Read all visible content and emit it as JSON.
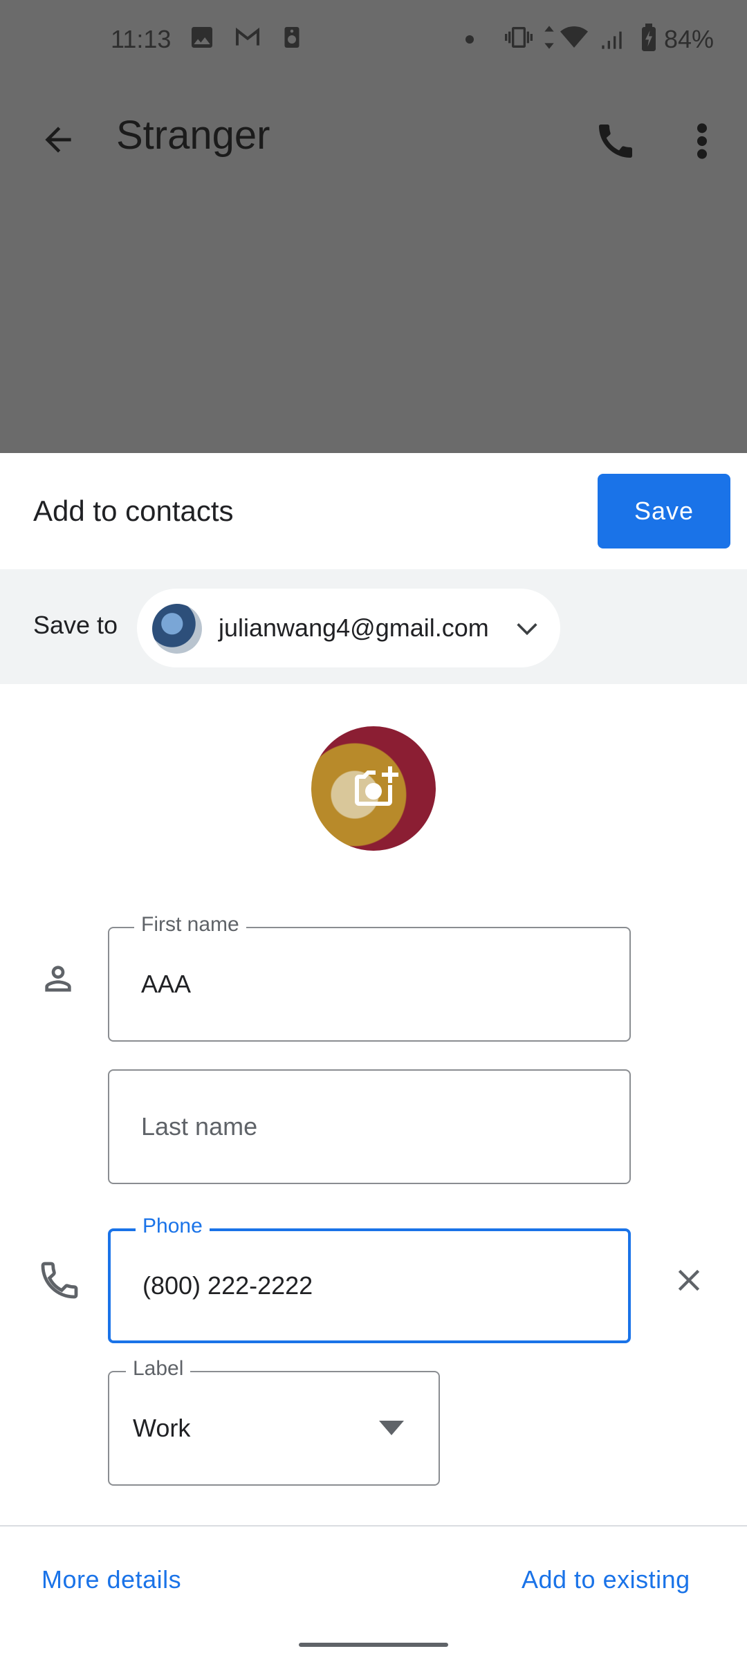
{
  "status_bar": {
    "time": "11:13",
    "battery": "84%",
    "icons": [
      "image-icon",
      "gmail-icon",
      "speaker-icon",
      "dot-icon",
      "vibrate-icon",
      "data-icon",
      "wifi-icon",
      "signal-icon",
      "battery-icon"
    ]
  },
  "app_bar": {
    "title": "Stranger",
    "icons": [
      "back-arrow-icon",
      "phone-icon",
      "more-vert-icon"
    ]
  },
  "sheet": {
    "title": "Add to contacts",
    "save_label": "Save",
    "save_to": {
      "label": "Save to",
      "account": "julianwang4@gmail.com"
    },
    "fields": {
      "first_name": {
        "label": "First name",
        "value": "AAA"
      },
      "last_name": {
        "placeholder": "Last name"
      },
      "phone": {
        "label": "Phone",
        "value": "(800) 222-2222"
      },
      "phone_label": {
        "label": "Label",
        "value": "Work"
      }
    },
    "footer": {
      "more_details": "More details",
      "add_existing": "Add to existing"
    }
  },
  "colors": {
    "accent": "#1a73e8",
    "scrim": "#6b6b6b",
    "chip_bg": "#f1f3f4"
  }
}
